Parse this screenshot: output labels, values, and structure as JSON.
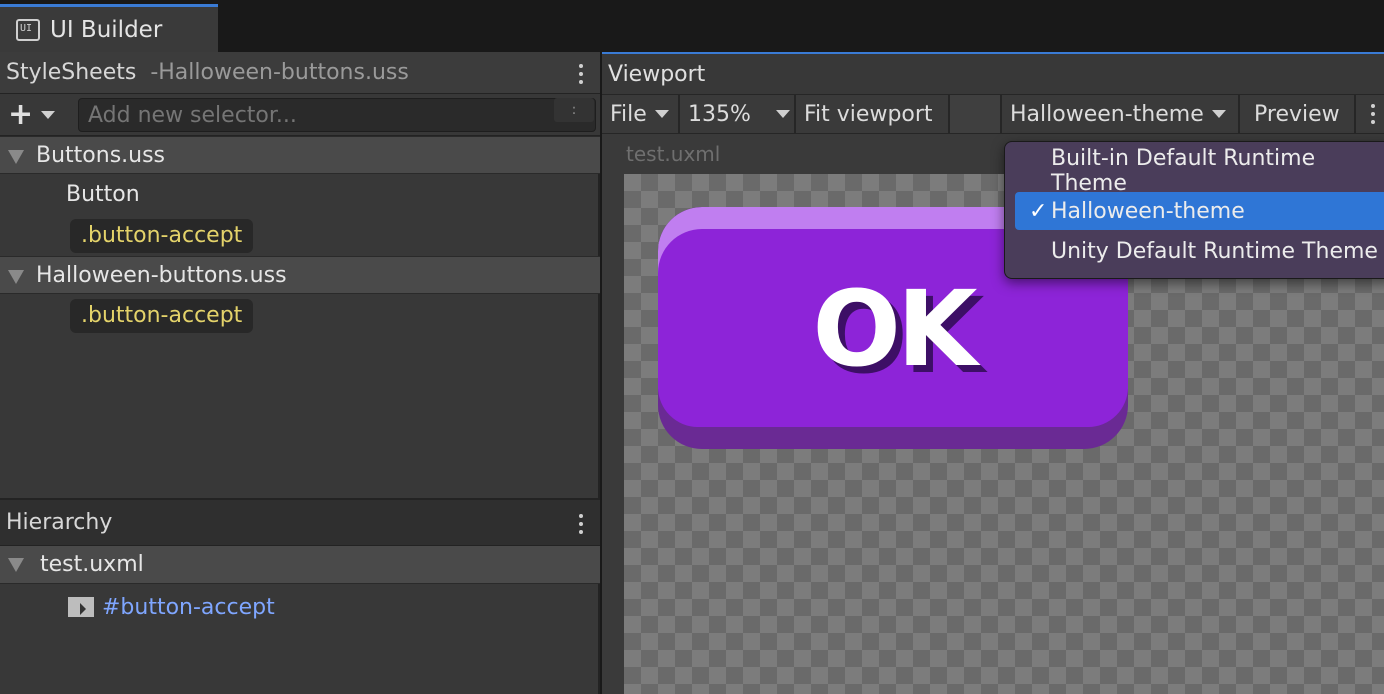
{
  "window": {
    "tab_title": "UI Builder",
    "tab_icon": "ui-builder-icon"
  },
  "stylesheets": {
    "title": "StyleSheets",
    "subtitle": "-Halloween-buttons.uss",
    "add_selector_placeholder": "Add new selector...",
    "colon": ":",
    "groups": [
      {
        "name": "Buttons.uss",
        "rules": [
          "Button",
          ".button-accept"
        ]
      },
      {
        "name": "Halloween-buttons.uss",
        "rules": [
          ".button-accept"
        ]
      }
    ]
  },
  "hierarchy": {
    "title": "Hierarchy",
    "file": "test.uxml",
    "element": "#button-accept"
  },
  "viewport": {
    "title": "Viewport",
    "toolbar": {
      "file": "File",
      "zoom": "135%",
      "fit": "Fit viewport",
      "theme": "Halloween-theme",
      "preview": "Preview"
    },
    "canvas_title": "test.uxml",
    "button_text": "OK"
  },
  "theme_menu": {
    "items": [
      {
        "label": "Built-in Default Runtime Theme",
        "selected": false
      },
      {
        "label": "Halloween-theme",
        "selected": true
      },
      {
        "label": "Unity Default Runtime Theme",
        "selected": false
      }
    ],
    "check": "✓"
  },
  "colors": {
    "accent": "#3a7bd5",
    "selector_yellow": "#e4d36a",
    "element_blue": "#7fa6ff",
    "ok_purple": "#8d24d8",
    "menu_selected": "#2f76d6"
  }
}
